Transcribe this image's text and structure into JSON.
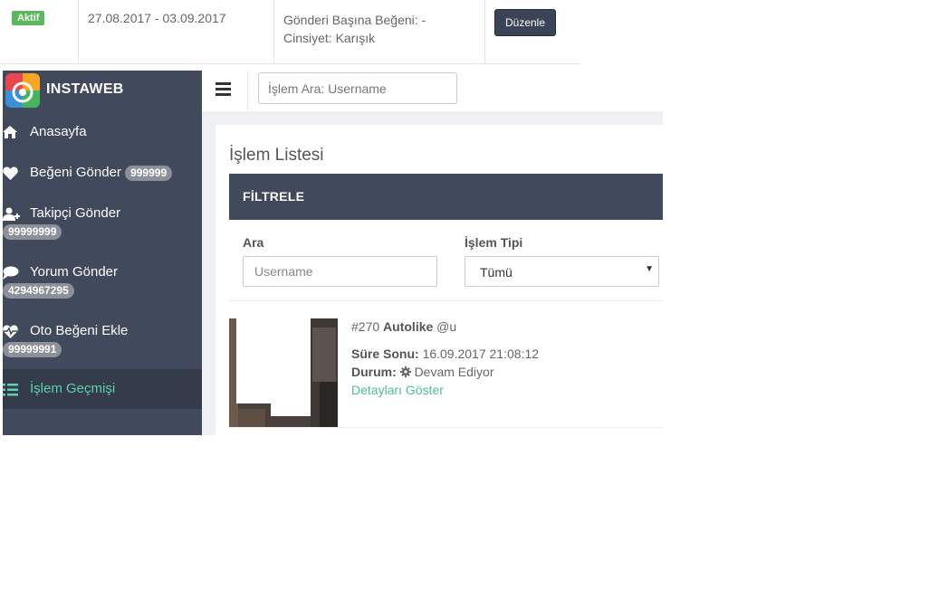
{
  "top_table": {
    "status_badge": "Aktif",
    "date_range": "27.08.2017 - 03.09.2017",
    "info_line1": "Gönderi Başına Beğeni: -",
    "info_line2": "Cinsiyet: Karışık",
    "edit_button": "Düzenle"
  },
  "brand": {
    "name": "INSTAWEB"
  },
  "sidebar": {
    "items": [
      {
        "label": "Anasayfa",
        "icon": "home-icon"
      },
      {
        "label": "Beğeni Gönder",
        "badge": "999999",
        "icon": "heart-icon"
      },
      {
        "label": "Takipçi Gönder",
        "badge": "99999999",
        "icon": "user-plus-icon"
      },
      {
        "label": "Yorum Gönder",
        "badge": "4294967295",
        "icon": "comment-icon"
      },
      {
        "label": "Oto Beğeni Ekle",
        "badge": "99999991",
        "icon": "heartbeat-icon"
      },
      {
        "label": "İşlem Geçmişi",
        "icon": "list-icon",
        "active": true
      }
    ]
  },
  "header": {
    "search_placeholder": "İşlem Ara: Username"
  },
  "panel": {
    "title": "İşlem Listesi",
    "filter_label": "FİLTRELE",
    "search_label": "Ara",
    "search_placeholder": "Username",
    "type_label": "İşlem Tipi",
    "type_value": "Tümü"
  },
  "item": {
    "id": "#270",
    "type": "Autolike",
    "username": "@u",
    "end_label": "Süre Sonu:",
    "end_value": "16.09.2017 21:08:12",
    "status_label": "Durum:",
    "status_value": "Devam Ediyor",
    "details_link": "Detayları Göster"
  },
  "colors": {
    "sidebar": "#414a5c",
    "accent": "#4dbd9d",
    "badge_active": "#5cb85c"
  }
}
